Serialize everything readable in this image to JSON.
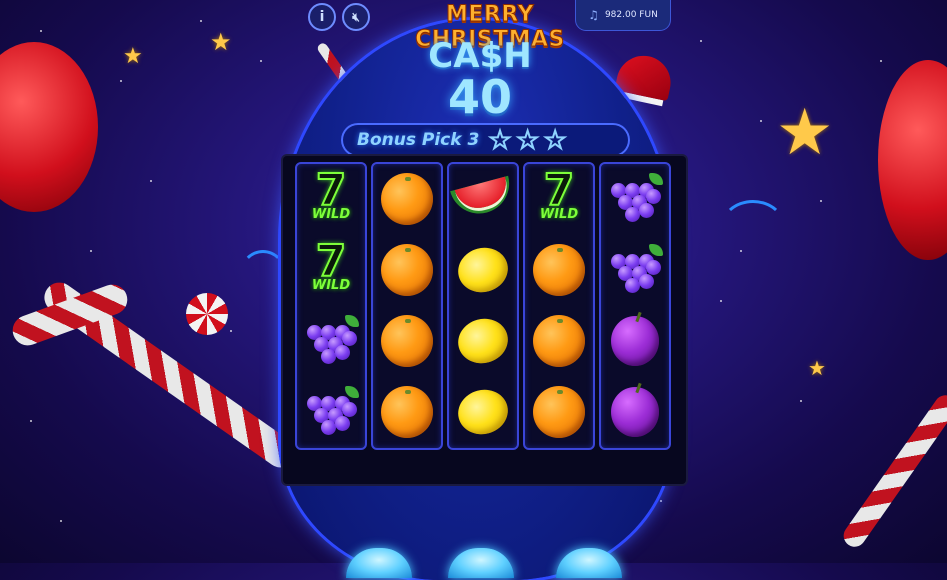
{
  "header": {
    "title_line1": "MERRY CHRISTMAS",
    "title_line2": "CA$H",
    "title_line3": "40",
    "bonus_label": "Bonus Pick 3",
    "bonus_stars": [
      "star-outline-icon",
      "star-outline-icon",
      "star-outline-icon"
    ]
  },
  "controls": {
    "info_icon": "i",
    "sound_icon": "speaker-muted-icon",
    "balance_icon": "music-note-icon",
    "balance_value": "982.00 FUN"
  },
  "reels": [
    [
      "wild",
      "wild",
      "grapes",
      "grapes"
    ],
    [
      "orange",
      "orange",
      "orange",
      "orange"
    ],
    [
      "watermelon",
      "lemon",
      "lemon",
      "lemon"
    ],
    [
      "wild",
      "orange",
      "orange",
      "orange"
    ],
    [
      "grapes",
      "grapes",
      "plum",
      "plum"
    ]
  ],
  "symbols": {
    "wild_digit": "7",
    "wild_text": "WILD"
  },
  "colors": {
    "background": "#24167a",
    "frame_accent": "#3a45d8",
    "title_gold": "#ffb02e",
    "title_ice": "#9fe6ff",
    "wild_green": "#7dff3a"
  }
}
